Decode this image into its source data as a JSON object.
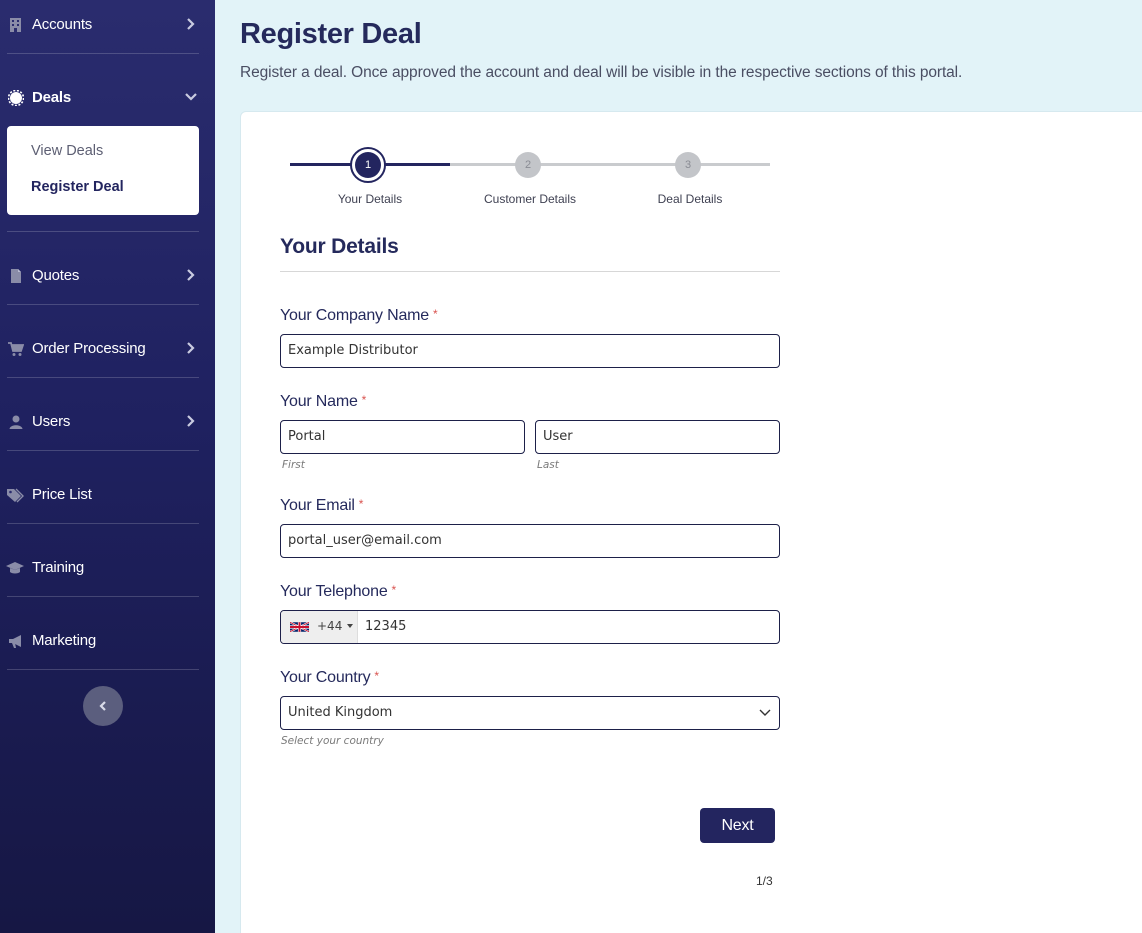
{
  "sidebar": {
    "items": [
      {
        "label": "Accounts",
        "icon": "building-icon"
      },
      {
        "label": "Deals",
        "icon": "gear-badge-icon"
      },
      {
        "label": "Quotes",
        "icon": "document-icon"
      },
      {
        "label": "Order Processing",
        "icon": "cart-icon"
      },
      {
        "label": "Users",
        "icon": "user-icon"
      },
      {
        "label": "Price List",
        "icon": "tags-icon"
      },
      {
        "label": "Training",
        "icon": "graduation-cap-icon"
      },
      {
        "label": "Marketing",
        "icon": "megaphone-icon"
      }
    ],
    "deals_submenu": [
      {
        "label": "View Deals"
      },
      {
        "label": "Register Deal"
      }
    ],
    "collapse_icon": "chevron-left-icon"
  },
  "header": {
    "title": "Register Deal",
    "subtitle": "Register a deal. Once approved the account and deal will be visible in the respective sections of this portal."
  },
  "stepper": {
    "steps": [
      {
        "number": "1",
        "label": "Your Details"
      },
      {
        "number": "2",
        "label": "Customer Details"
      },
      {
        "number": "3",
        "label": "Deal Details"
      }
    ],
    "active_color": "#23255f",
    "inactive_color": "#c3c5c9"
  },
  "form": {
    "section_title": "Your Details",
    "required_mark": "*",
    "company": {
      "label": "Your Company Name",
      "value": "Example Distributor"
    },
    "name": {
      "label": "Your Name",
      "first_value": "Portal",
      "last_value": "User",
      "first_hint": "First",
      "last_hint": "Last"
    },
    "email": {
      "label": "Your Email",
      "value": "portal_user@email.com"
    },
    "telephone": {
      "label": "Your Telephone",
      "dial_code": "+44",
      "value": "12345"
    },
    "country": {
      "label": "Your Country",
      "value": "United Kingdom",
      "hint": "Select your country"
    },
    "next_label": "Next",
    "page_indicator": "1/3"
  },
  "colors": {
    "brand": "#23255f",
    "background": "#e2f3f8",
    "required": "#d9534f"
  }
}
